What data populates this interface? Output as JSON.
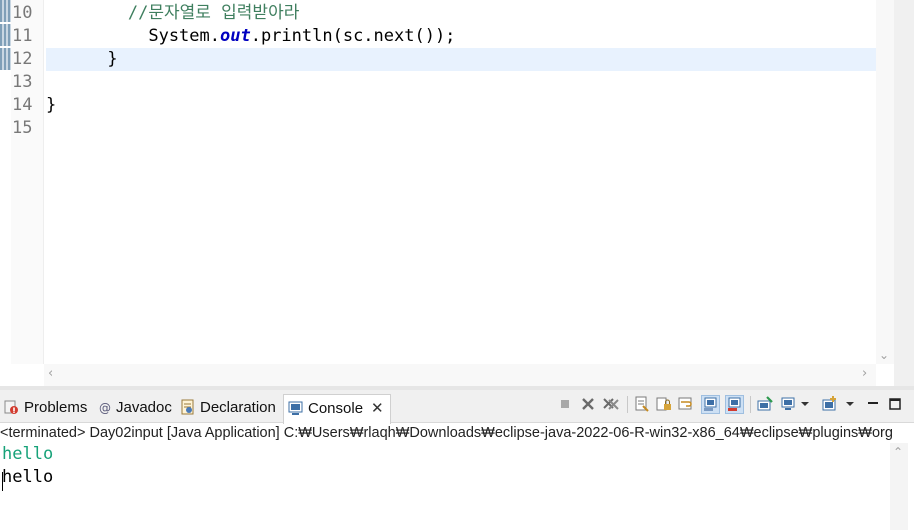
{
  "editor": {
    "lines": [
      {
        "num": "10",
        "parts": [
          {
            "t": "        ",
            "c": "plain"
          },
          {
            "t": "//문자열로 입력받아라",
            "c": "comment"
          }
        ]
      },
      {
        "num": "11",
        "parts": [
          {
            "t": "          System.",
            "c": "plain"
          },
          {
            "t": "out",
            "c": "field"
          },
          {
            "t": ".println(sc.next());",
            "c": "plain"
          }
        ]
      },
      {
        "num": "12",
        "parts": [
          {
            "t": "      }",
            "c": "plain"
          }
        ]
      },
      {
        "num": "13",
        "parts": []
      },
      {
        "num": "14",
        "parts": [
          {
            "t": "}",
            "c": "plain"
          }
        ]
      },
      {
        "num": "15",
        "parts": []
      }
    ],
    "current_line": "12",
    "colors": {
      "comment": "#3f7f5f",
      "field": "#0000c0",
      "current_line_bg": "#e8f2fe"
    }
  },
  "view": {
    "tabs": [
      {
        "label": "Problems",
        "icon": "problems-icon"
      },
      {
        "label": "Javadoc",
        "icon": "javadoc-icon"
      },
      {
        "label": "Declaration",
        "icon": "declaration-icon"
      },
      {
        "label": "Console",
        "icon": "console-icon",
        "active": true
      }
    ],
    "toolbar_icons": [
      "terminate-icon",
      "remove-launch-icon",
      "remove-all-terminated-icon",
      "clear-console-icon",
      "scroll-lock-icon",
      "word-wrap-icon",
      "show-on-stdout-icon",
      "show-on-stderr-icon",
      "pin-console-icon",
      "display-selected-console-icon",
      "open-console-icon",
      "minimize-icon",
      "maximize-icon"
    ],
    "status": "<terminated> Day02input [Java Application] C:₩Users₩rlaqh₩Downloads₩eclipse-java-2022-06-R-win32-x86_64₩eclipse₩plugins₩org",
    "console_lines": [
      {
        "text": "hello",
        "color": "#17a279"
      },
      {
        "text": "hello",
        "color": "#000000"
      }
    ]
  }
}
